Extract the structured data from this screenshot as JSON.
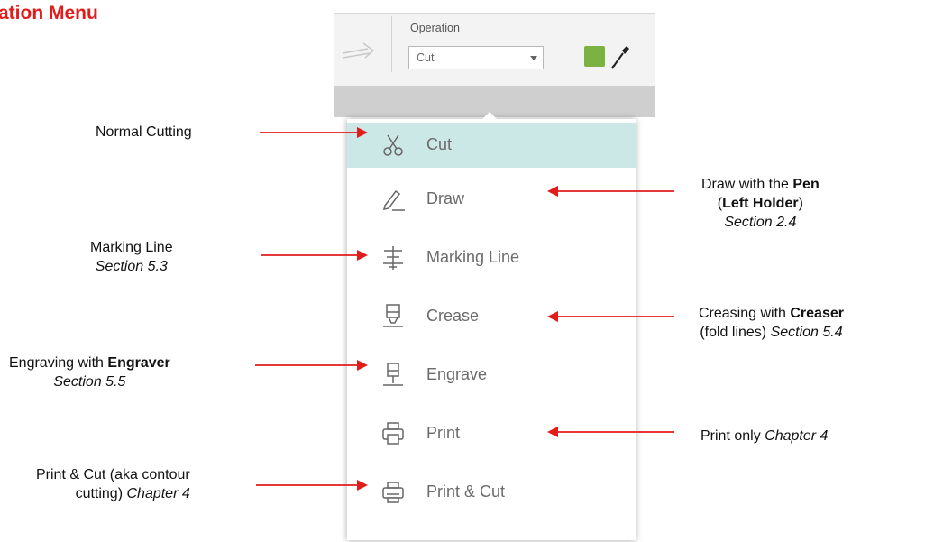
{
  "title": "ation Menu",
  "toolbar": {
    "operation_label": "Operation",
    "operation_value": "Cut",
    "swatch_color": "#7bb241",
    "icons": [
      "redo-icon",
      "eyedropper-icon"
    ]
  },
  "menu": {
    "items": [
      {
        "label": "Cut",
        "icon": "scissors-icon",
        "selected": true
      },
      {
        "label": "Draw",
        "icon": "pen-icon"
      },
      {
        "label": "Marking Line",
        "icon": "marking-line-icon"
      },
      {
        "label": "Crease",
        "icon": "creaser-icon"
      },
      {
        "label": "Engrave",
        "icon": "engraver-icon"
      },
      {
        "label": "Print",
        "icon": "printer-icon"
      },
      {
        "label": "Print & Cut",
        "icon": "print-cut-icon"
      }
    ]
  },
  "annotations": {
    "normal_cutting": "Normal Cutting",
    "marking_line": {
      "line1": "Marking Line",
      "line2": "Section 5.3"
    },
    "engraving": {
      "pre": "Engraving with ",
      "bold": "Engraver",
      "line2": "Section 5.5"
    },
    "print_cut": {
      "line1": "Print & Cut (aka contour",
      "line2_pre": "cutting) ",
      "line2_italic": "Chapter 4"
    },
    "draw": {
      "pre": "Draw with the ",
      "bold": "Pen",
      "line2_open": "(",
      "line2_bold": "Left Holder",
      "line2_close": ")",
      "line3": "Section 2.4"
    },
    "creasing": {
      "pre": "Creasing with ",
      "bold": "Creaser",
      "line2_pre": "(fold lines) ",
      "line2_italic": "Section 5.4"
    },
    "print_only": {
      "pre": "Print only  ",
      "italic": "Chapter 4"
    }
  },
  "colors": {
    "title": "#e21b1b",
    "arrow": "#e21b1b",
    "selected_row": "#cbe8e6"
  }
}
